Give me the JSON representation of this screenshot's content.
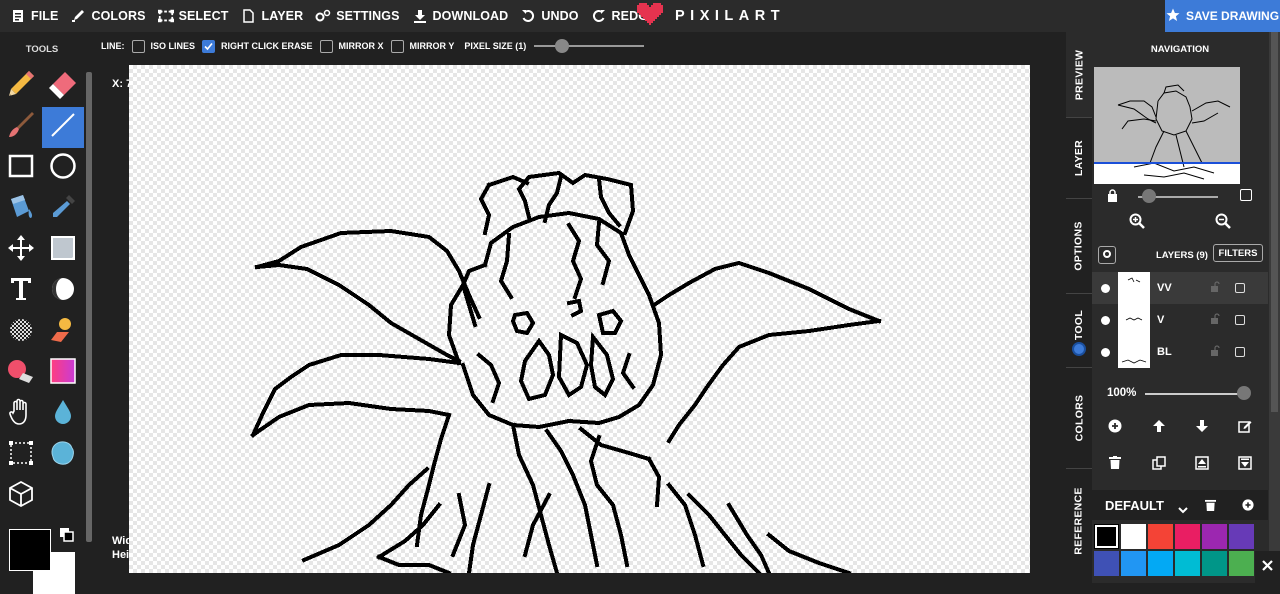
{
  "menu": [
    {
      "name": "file",
      "label": "FILE"
    },
    {
      "name": "colors",
      "label": "COLORS"
    },
    {
      "name": "select",
      "label": "SELECT"
    },
    {
      "name": "layer",
      "label": "LAYER"
    },
    {
      "name": "settings",
      "label": "SETTINGS"
    },
    {
      "name": "download",
      "label": "DOWNLOAD"
    },
    {
      "name": "undo",
      "label": "UNDO"
    },
    {
      "name": "redo",
      "label": "REDO"
    }
  ],
  "brand": {
    "text": "PIXILART",
    "color": "#e5334f"
  },
  "save": {
    "label": "SAVE DRAWING",
    "color": "#3d7bd8"
  },
  "tools": {
    "title": "TOOLS"
  },
  "options": {
    "line_label": "LINE:",
    "iso_lines": {
      "label": "ISO LINES",
      "checked": false
    },
    "right_click_erase": {
      "label": "RIGHT CLICK ERASE",
      "checked": true
    },
    "mirror_x": {
      "label": "MIRROR X",
      "checked": false
    },
    "mirror_y": {
      "label": "MIRROR Y",
      "checked": false
    },
    "pixel_size": {
      "label": "PIXEL SIZE (1)",
      "value": 1
    }
  },
  "workspace": {
    "coord_label": "X: 7",
    "width_label": "Wid",
    "height_label": "Hei"
  },
  "side_tabs": [
    {
      "name": "preview",
      "label": "PREVIEW"
    },
    {
      "name": "layer",
      "label": "LAYER"
    },
    {
      "name": "options",
      "label": "OPTIONS"
    },
    {
      "name": "tool",
      "label": "TOOL"
    },
    {
      "name": "colors",
      "label": "COLORS"
    },
    {
      "name": "reference",
      "label": "REFERENCE"
    }
  ],
  "navigation": {
    "title": "NAVIGATION"
  },
  "layers": {
    "title": "LAYERS (9)",
    "filters_label": "FILTERS",
    "items": [
      {
        "name": "VV",
        "selected": true
      },
      {
        "name": "V",
        "selected": false
      },
      {
        "name": "BL",
        "selected": false
      }
    ],
    "opacity_label": "100%",
    "opacity_value": 100
  },
  "palette": {
    "name": "DEFAULT",
    "swatches": [
      "#000000",
      "#ffffff",
      "#f44336",
      "#e91e63",
      "#9c27b0",
      "#673ab7",
      "#3f51b5",
      "#2196f3",
      "#03a9f4",
      "#00bcd4",
      "#009688",
      "#4caf50"
    ]
  },
  "accent": "#3d7bd8"
}
